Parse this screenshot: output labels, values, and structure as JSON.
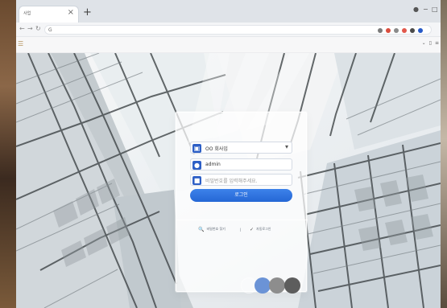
{
  "browser": {
    "tab_title": "사업",
    "tab_close": "×",
    "new_tab": "+",
    "address": "G",
    "bookmarks_menu": "☰",
    "bookmarks_right_1": "⌄",
    "bookmarks_right_2": "▯",
    "bookmarks_right_3": "≡"
  },
  "login": {
    "company_value": "OO 회사입",
    "username_value": "admin",
    "password_placeholder": "비밀번호를 입력해주세요.",
    "login_label": "로그인",
    "find_password_label": "비밀번호 찾기",
    "remember_label": "자동로그인",
    "separator": "|"
  },
  "icons": {
    "window_dot": "●",
    "min": "−",
    "restore": "□",
    "back": "←",
    "forward": "→",
    "refresh": "↻",
    "company_icon": "▣",
    "user_icon": "●",
    "lock_icon": "■",
    "dropdown_icon": "▾",
    "search_icon": "🔍",
    "check_icon": "✓"
  },
  "colors": {
    "accent": "#2567d5",
    "panel": "#ffffff",
    "dock_blue": "#6b93d6",
    "dock_gray": "#8d8d8d",
    "dock_dark": "#5d5d5d"
  }
}
